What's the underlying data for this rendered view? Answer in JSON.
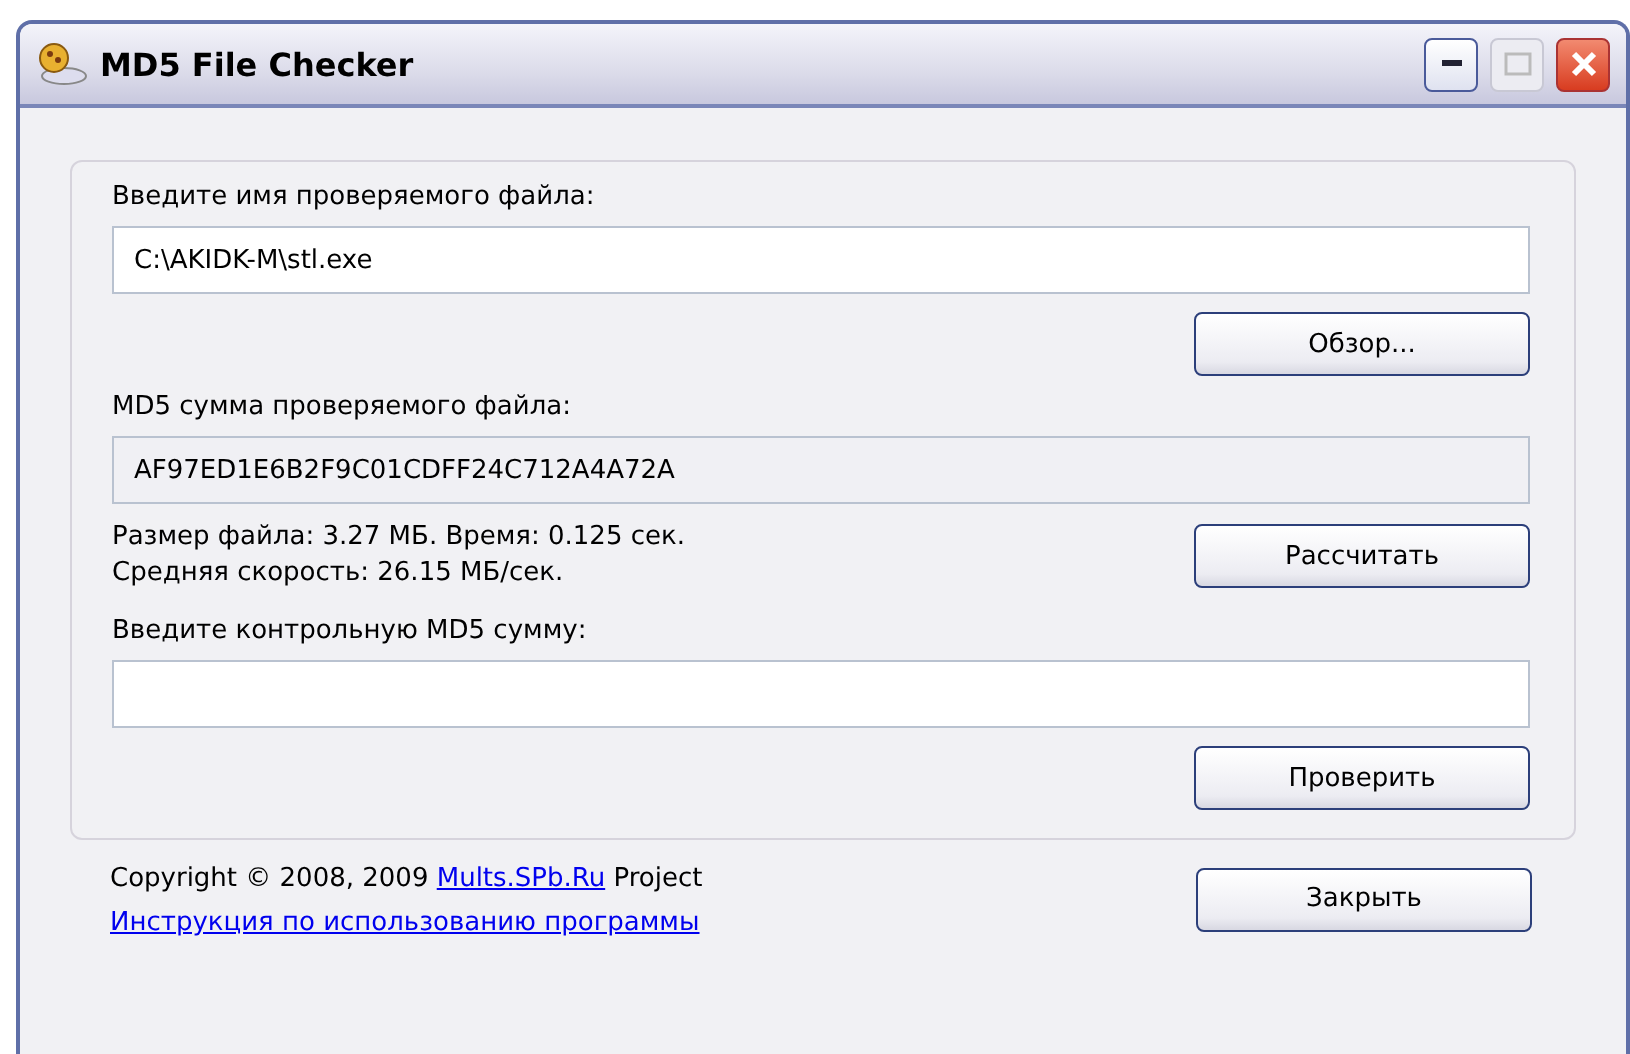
{
  "window": {
    "title": "MD5 File Checker"
  },
  "file": {
    "label": "Введите имя проверяемого файла:",
    "value": "C:\\AKIDK-M\\stl.exe",
    "button": "Обзор..."
  },
  "md5": {
    "label": "MD5 сумма проверяемого файла:",
    "value": "AF97ED1E6B2F9C01CDFF24C712A4A72A"
  },
  "stats": [
    "Размер файла: 3.27 МБ. Время: 0.125 сек.",
    "Средняя скорость: 26.15 МБ/сек."
  ],
  "calculate_button": "Рассчитать",
  "check": {
    "label": "Введите контрольную MD5 сумму:",
    "button": "Проверить"
  },
  "copyright": {
    "before": "Copyright © 2008, 2009 ",
    "link": "Mults.SPb.Ru",
    "after": " Project"
  },
  "manual_link": "Инструкция по использованию программы",
  "close_button": "Закрыть"
}
